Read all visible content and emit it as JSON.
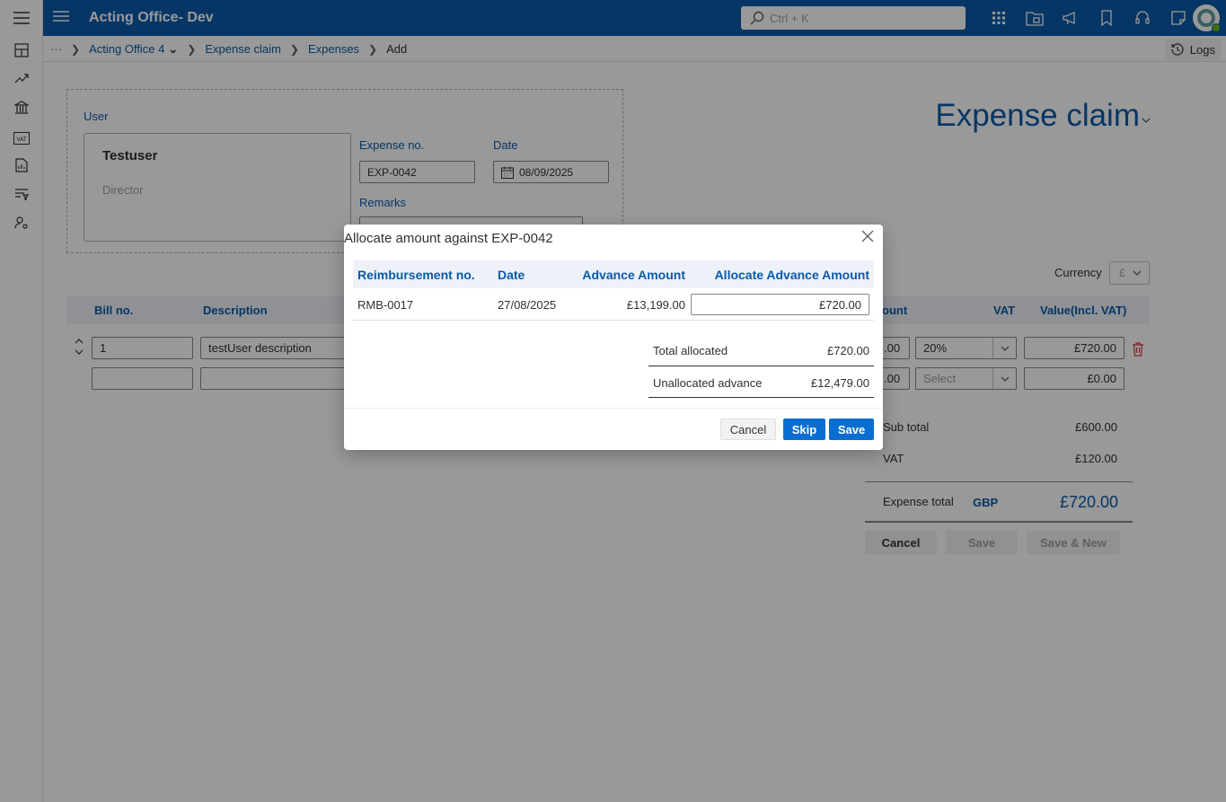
{
  "app": {
    "title": "Acting Office- Dev",
    "search_placeholder": "Ctrl + K",
    "brand_color": "#0a5aa8"
  },
  "breadcrumb": {
    "more": "···",
    "items": [
      "Acting Office 4",
      "Expense claim",
      "Expenses"
    ],
    "current": "Add",
    "logs_label": "Logs"
  },
  "form": {
    "page_title": "Expense claim",
    "user_label": "User",
    "user_name": "Testuser",
    "user_role": "Director",
    "expense_no_label": "Expense no.",
    "expense_no_value": "EXP-0042",
    "date_label": "Date",
    "date_value": "08/09/2025",
    "remarks_label": "Remarks",
    "currency_label": "Currency",
    "currency_value": "£"
  },
  "table": {
    "headers": {
      "bill_no": "Bill no.",
      "description": "Description",
      "amount": "ount",
      "vat": "VAT",
      "value": "Value(Incl. VAT)"
    },
    "rows": [
      {
        "bill_no": "1",
        "description": "testUser description",
        "amount": ".00",
        "vat": "20%",
        "value": "£720.00"
      },
      {
        "bill_no": "",
        "description": "",
        "amount": ".00",
        "vat": "Select",
        "value": "£0.00"
      }
    ]
  },
  "totals": {
    "subtotal_label": "Sub total",
    "subtotal_value": "£600.00",
    "vat_label": "VAT",
    "vat_value": "£120.00",
    "expense_total_label": "Expense total",
    "currency_code": "GBP",
    "expense_total_value": "£720.00"
  },
  "actions": {
    "cancel": "Cancel",
    "save": "Save",
    "save_new": "Save & New"
  },
  "modal": {
    "title": "Allocate amount against EXP-0042",
    "headers": {
      "reimbursement_no": "Reimbursement no.",
      "date": "Date",
      "advance_amount": "Advance Amount",
      "allocate_amount": "Allocate Advance Amount"
    },
    "rows": [
      {
        "reimbursement_no": "RMB-0017",
        "date": "27/08/2025",
        "advance_amount": "£13,199.00",
        "allocate_amount": "£720.00"
      }
    ],
    "total_allocated_label": "Total allocated",
    "total_allocated_value": "£720.00",
    "unallocated_label": "Unallocated advance",
    "unallocated_value": "£12,479.00",
    "cancel": "Cancel",
    "skip": "Skip",
    "save": "Save"
  }
}
